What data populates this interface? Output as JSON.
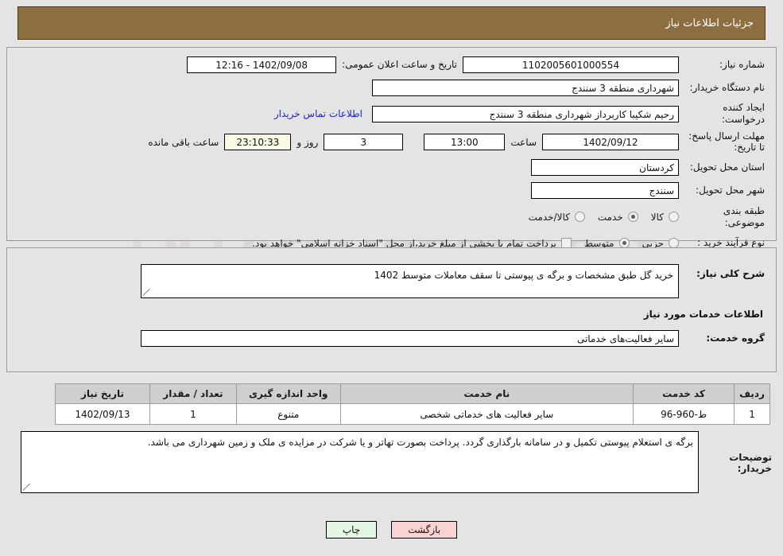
{
  "header": {
    "title": "جزئیات اطلاعات نیاز"
  },
  "watermark": {
    "text": "AriaTender.net",
    "shield_icon": "shield-icon"
  },
  "need_info": {
    "need_no_label": "شماره نیاز:",
    "need_no_value": "1102005601000554",
    "public_announce_label": "تاریخ و ساعت اعلان عمومی:",
    "public_announce_value": "1402/09/08 - 12:16",
    "buyer_org_label": "نام دستگاه خریدار:",
    "buyer_org_value": "شهرداری منطقه 3 سنندج",
    "creator_label": "ایجاد کننده درخواست:",
    "creator_value": "رحیم شکیبا کاربرداز شهرداری منطقه 3 سنندج",
    "buyer_contact_link": "اطلاعات تماس خریدار",
    "deadline_label": "مهلت ارسال پاسخ: تا تاریخ:",
    "deadline_date": "1402/09/12",
    "time_label": "ساعت",
    "deadline_time": "13:00",
    "days_remaining": "3",
    "days_label": "روز و",
    "countdown": "23:10:33",
    "remaining_label": "ساعت باقی مانده",
    "province_label": "استان محل تحویل:",
    "province_value": "کردستان",
    "city_label": "شهر محل تحویل:",
    "city_value": "سنندج",
    "category_label": "طبقه بندی موضوعی:",
    "category_options": [
      {
        "label": "کالا",
        "selected": false
      },
      {
        "label": "خدمت",
        "selected": true
      },
      {
        "label": "کالا/خدمت",
        "selected": false
      }
    ],
    "process_label": "نوع فرآیند خرید :",
    "process_options": [
      {
        "label": "جزیی",
        "selected": false
      },
      {
        "label": "متوسط",
        "selected": true
      }
    ],
    "treasury_checkbox_checked": false,
    "treasury_note": "پرداخت تمام یا بخشی از مبلغ خرید،از محل \"اسناد خزانه اسلامی\" خواهد بود."
  },
  "description": {
    "general_label": "شرح کلی نیاز:",
    "general_value": "خرید گل طبق مشخصات و برگه ی پیوستی تا سقف معاملات متوسط 1402",
    "services_section_title": "اطلاعات خدمات مورد نیاز",
    "service_group_label": "گروه خدمت:",
    "service_group_value": "سایر فعالیت‌های خدماتی"
  },
  "items_table": {
    "columns": [
      "ردیف",
      "کد خدمت",
      "نام خدمت",
      "واحد اندازه گیری",
      "تعداد / مقدار",
      "تاریخ نیاز"
    ],
    "rows": [
      {
        "radif": "1",
        "code": "ط-960-96",
        "name": "سایر فعالیت های خدماتی شخصی",
        "unit": "متنوع",
        "qty": "1",
        "date": "1402/09/13"
      }
    ]
  },
  "buyer_notes": {
    "label": "توضیحات خریدار:",
    "value": "برگه ی استعلام پیوستی تکمیل و در سامانه بارگذاری گردد. پرداخت بصورت تهاتر و یا شرکت در مزایده ی ملک و زمین شهرداری می باشد."
  },
  "footer": {
    "print_label": "چاپ",
    "back_label": "بازگشت"
  }
}
